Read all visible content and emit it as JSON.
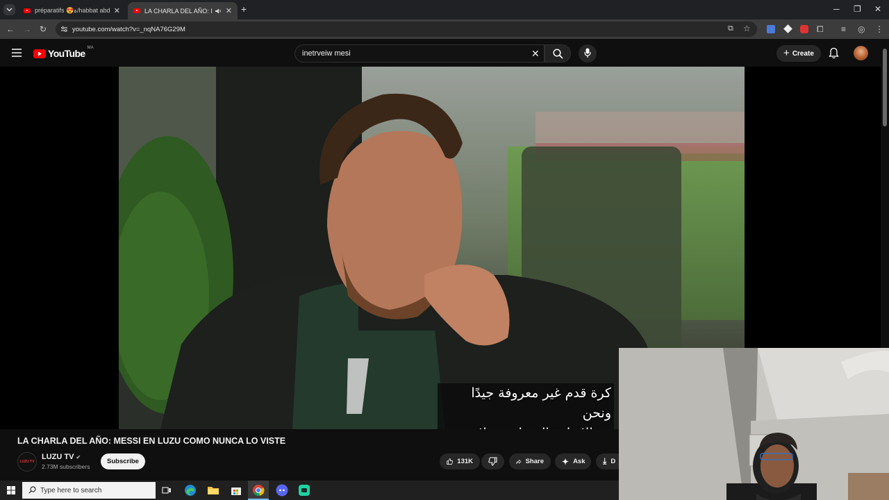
{
  "browser": {
    "tabs": [
      {
        "title": "préparatifs 😍ة/habbat abdel",
        "active": false
      },
      {
        "title": "LA CHARLA DEL AÑO: MES",
        "active": true
      }
    ],
    "new_tab_icon": "plus-icon",
    "url": "youtube.com/watch?v=_nqNA76G29M"
  },
  "youtube": {
    "logo_text": "YouTube",
    "region": "MA",
    "search_value": "inetrveiw mesi",
    "create_label": "Create",
    "video": {
      "caption_lines": [
        "كرة قدم غير معروفة جيدًا ونحن",
        "مع الإشارة إلى نادي ميلانو الذي"
      ],
      "title": "LA CHARLA DEL AÑO: MESSI EN LUZU COMO NUNCA LO VISTE"
    },
    "channel": {
      "avatar_text": "LUZU TV",
      "name": "LUZU TV",
      "subscribers": "2.73M subscribers",
      "subscribe_label": "Subscribe"
    },
    "actions": {
      "likes": "131K",
      "share_label": "Share",
      "ask_label": "Ask",
      "download_label": "D"
    }
  },
  "taskbar": {
    "search_placeholder": "Type here to search"
  }
}
